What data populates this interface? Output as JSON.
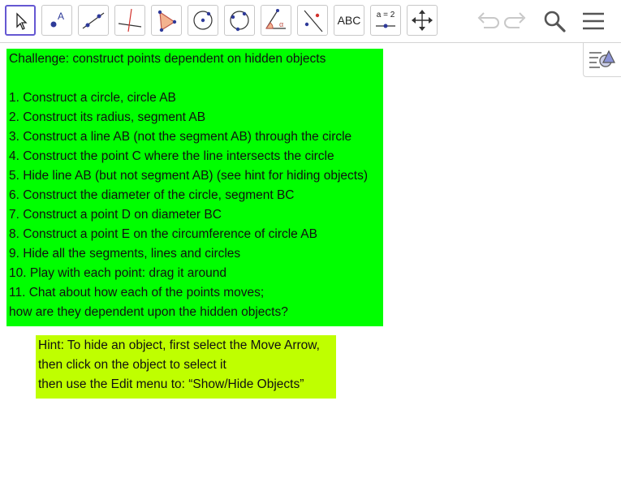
{
  "toolbar": {
    "tools": [
      {
        "icon": "move-arrow-icon",
        "active": true
      },
      {
        "icon": "point-icon"
      },
      {
        "icon": "line-icon"
      },
      {
        "icon": "perpendicular-line-icon"
      },
      {
        "icon": "polygon-icon"
      },
      {
        "icon": "circle-center-point-icon"
      },
      {
        "icon": "circle-three-points-icon"
      },
      {
        "icon": "angle-icon"
      },
      {
        "icon": "reflect-icon"
      },
      {
        "icon": "text-icon",
        "label": "ABC"
      },
      {
        "icon": "slider-icon",
        "label": "a = 2"
      },
      {
        "icon": "move-graphics-view-icon"
      }
    ],
    "undo_icon": "undo-icon",
    "redo_icon": "redo-icon",
    "search_icon": "search-icon",
    "menu_icon": "menu-icon"
  },
  "side_panel": {
    "icon": "algebra-view-toggle-icon"
  },
  "colors": {
    "challenge_bg": "#00ff00",
    "hint_bg": "#bfff00",
    "active_tool_border": "#6557d2"
  },
  "challenge": {
    "lines": [
      "Challenge: construct points dependent on hidden objects",
      "",
      "1. Construct a circle, circle AB",
      "2. Construct its radius, segment AB",
      "3. Construct a line AB (not the segment AB) through the circle",
      "4. Construct the point C where the line intersects the circle",
      "5. Hide line AB (but not segment AB) (see hint for hiding objects)",
      "6. Construct the diameter of the circle, segment BC",
      "7. Construct a point D on diameter BC",
      "8. Construct a point E on the circumference of circle AB",
      "9. Hide all the segments, lines and circles",
      "10. Play with each point: drag it around",
      "11. Chat about how each of the points moves;",
      "how are they dependent upon the hidden objects?"
    ]
  },
  "hint": {
    "lines": [
      "Hint: To hide an object, first select the Move Arrow,",
      "then click on the object to select it",
      "then use the Edit menu to: “Show/Hide Objects”"
    ]
  }
}
